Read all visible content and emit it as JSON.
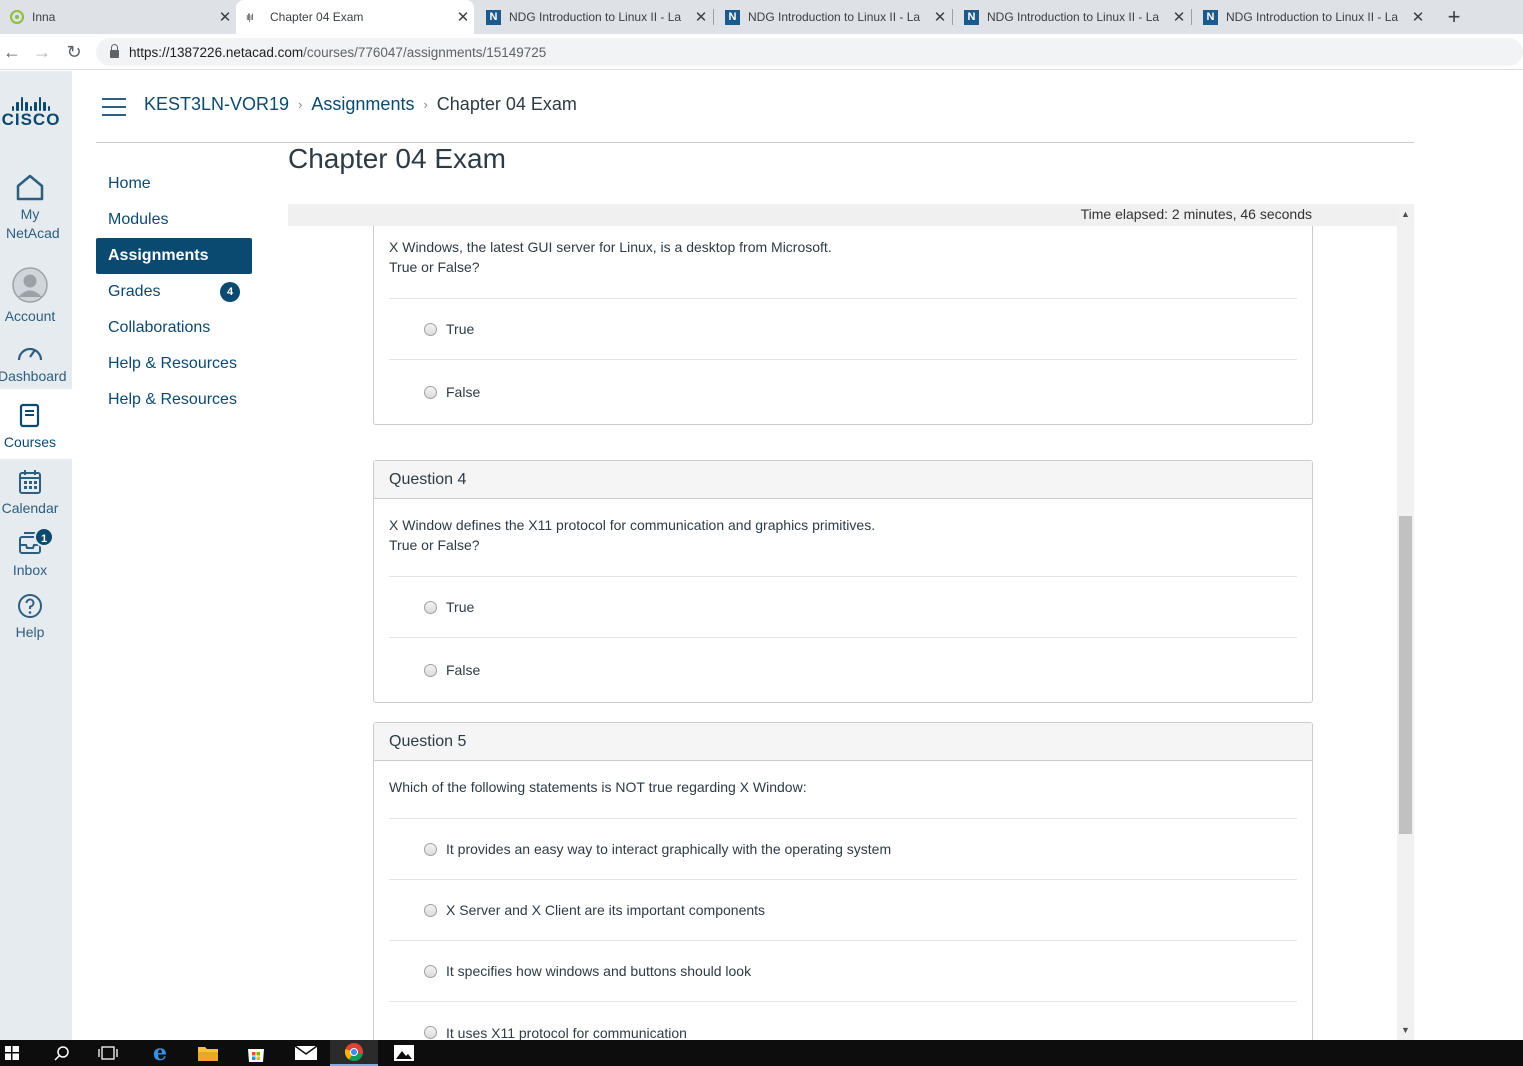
{
  "browser": {
    "tabs": [
      {
        "title": "Inna",
        "favicon": "inna-favicon"
      },
      {
        "title": "Chapter 04 Exam",
        "favicon": "cisco-favicon"
      },
      {
        "title": "NDG Introduction to Linux II - La",
        "favicon": "ndg-favicon"
      },
      {
        "title": "NDG Introduction to Linux II - La",
        "favicon": "ndg-favicon"
      },
      {
        "title": "NDG Introduction to Linux II - La",
        "favicon": "ndg-favicon"
      },
      {
        "title": "NDG Introduction to Linux II - La",
        "favicon": "ndg-favicon"
      }
    ],
    "url_host": "https://1387226.netacad.com",
    "url_path": "/courses/776047/assignments/15149725"
  },
  "global_nav": {
    "logo_text": "CISCO",
    "items": [
      {
        "label": "My NetAcad",
        "icon": "home-icon"
      },
      {
        "label": "Account",
        "icon": "avatar-icon"
      },
      {
        "label": "Dashboard",
        "icon": "dashboard-icon"
      },
      {
        "label": "Courses",
        "icon": "courses-icon"
      },
      {
        "label": "Calendar",
        "icon": "calendar-icon"
      },
      {
        "label": "Inbox",
        "icon": "inbox-icon",
        "badge": "1"
      },
      {
        "label": "Help",
        "icon": "help-icon"
      }
    ]
  },
  "breadcrumb": {
    "course": "KEST3LN-VOR19",
    "section": "Assignments",
    "current": "Chapter 04 Exam"
  },
  "course_nav": {
    "items": [
      {
        "label": "Home"
      },
      {
        "label": "Modules"
      },
      {
        "label": "Assignments"
      },
      {
        "label": "Grades",
        "badge": "4"
      },
      {
        "label": "Collaborations"
      },
      {
        "label": "Help & Resources"
      },
      {
        "label": "Help & Resources"
      }
    ]
  },
  "page": {
    "title": "Chapter 04 Exam",
    "timer": "Time elapsed: 2 minutes, 46 seconds"
  },
  "questions": [
    {
      "header": "",
      "text_line1": "X Windows, the latest GUI server for Linux, is a desktop from Microsoft.",
      "text_line2": "True or False?",
      "answers": [
        "True",
        "False"
      ]
    },
    {
      "header": "Question 4",
      "text_line1": "X Window defines the X11 protocol for communication and graphics primitives.",
      "text_line2": "True or False?",
      "answers": [
        "True",
        "False"
      ]
    },
    {
      "header": "Question 5",
      "text_line1": "Which of the following statements is NOT true regarding X Window:",
      "answers": [
        "It provides an easy way to interact graphically with the operating system",
        "X Server and X Client are its important components",
        "It specifies how windows and buttons should look",
        "It uses X11 protocol for communication"
      ]
    }
  ],
  "colors": {
    "brand": "#0b4a70",
    "nav_bg": "#e6ebef"
  }
}
